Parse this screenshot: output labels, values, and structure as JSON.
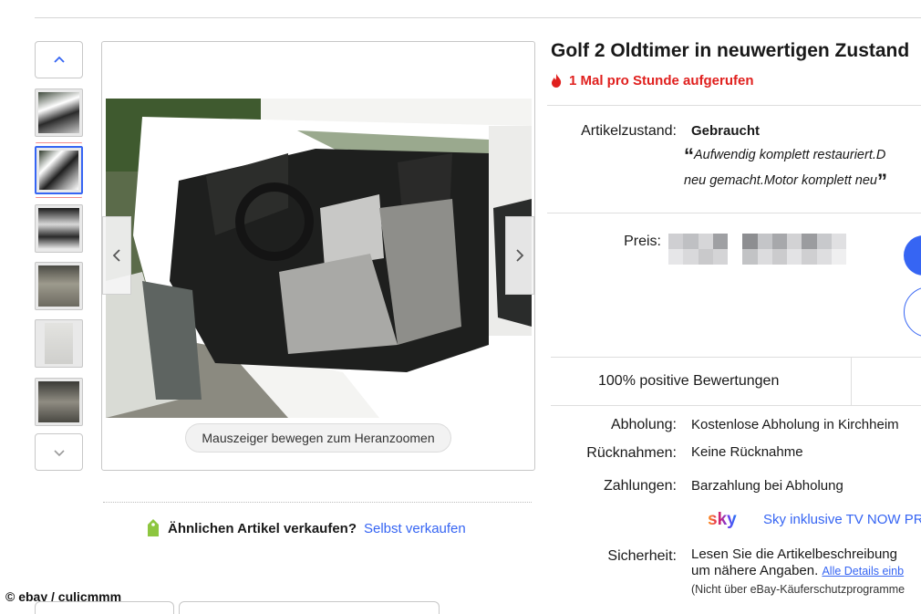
{
  "gallery": {
    "zoom_hint": "Mauszeiger bewegen zum Heranzoomen",
    "prev_icon": "chevron-left-icon",
    "next_icon": "chevron-right-icon",
    "thumb_up_icon": "chevron-up-icon",
    "thumb_down_icon": "chevron-down-icon",
    "active_thumbnail_index": 1,
    "thumbnail_count": 6
  },
  "sell_similar": {
    "question": "Ähnlichen Artikel verkaufen?",
    "link": "Selbst verkaufen"
  },
  "credit": "© ebay / culicmmm",
  "listing": {
    "title": "Golf 2 Oldtimer in neuwertigen Zustand",
    "watch_count_text": "1 Mal pro Stunde aufgerufen",
    "condition_label": "Artikelzustand:",
    "condition_value": "Gebraucht",
    "condition_quote_line1": "Aufwendig komplett restauriert.D",
    "condition_quote_line2": "neu gemacht.Motor komplett neu",
    "quote_open": "“",
    "quote_close": "”",
    "price_label": "Preis:",
    "feedback": "100% positive Bewertungen",
    "pickup_label": "Abholung:",
    "pickup_value": "Kostenlose Abholung in Kirchheim",
    "returns_label": "Rücknahmen:",
    "returns_value": "Keine Rücknahme",
    "payments_label": "Zahlungen:",
    "payments_value": "Barzahlung bei Abholung",
    "sky_logo_text": "sky",
    "sky_text": "Sky inklusive TV NOW PR",
    "security_label": "Sicherheit:",
    "security_line1": "Lesen Sie die Artikelbeschreibung",
    "security_line2": "um nähere Angaben.",
    "security_link": "Alle Details einb",
    "security_fine": "(Nicht über eBay-Käuferschutzprogramme"
  },
  "colors": {
    "accent_blue": "#3665f3",
    "watch_red": "#e0201e",
    "sky_gradient": [
      "#ff9a1f",
      "#e0205a",
      "#6a3cf0",
      "#1f7cf5"
    ]
  }
}
